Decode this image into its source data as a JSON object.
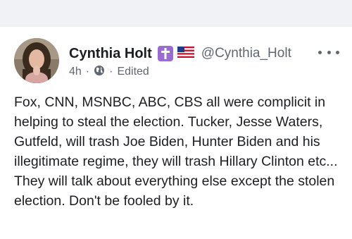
{
  "post": {
    "author_name": "Cynthia Holt",
    "handle": "@Cynthia_Holt",
    "time": "4h",
    "separator": "·",
    "edited_label": "Edited",
    "body_text": "Fox, CNN, MSNBC, ABC, CBS all were complicit in helping to steal the election. Tucker, Jesse Waters, Gutfeld, will trash Joe Biden, Hunter Biden and his illegitimate regime, they will trash Hillary Clinton etc... They will talk about everything else except the stolen election. Don't be fooled by it."
  },
  "icons": {
    "badge": "latin-cross-icon",
    "flag": "us-flag-icon",
    "audience": "globe-icon",
    "menu": "more-options-icon"
  },
  "colors": {
    "page_background": "#f0f2f5",
    "text_primary": "#1c1e21",
    "text_secondary": "#606770",
    "badge_purple": "#9a6bd1"
  }
}
